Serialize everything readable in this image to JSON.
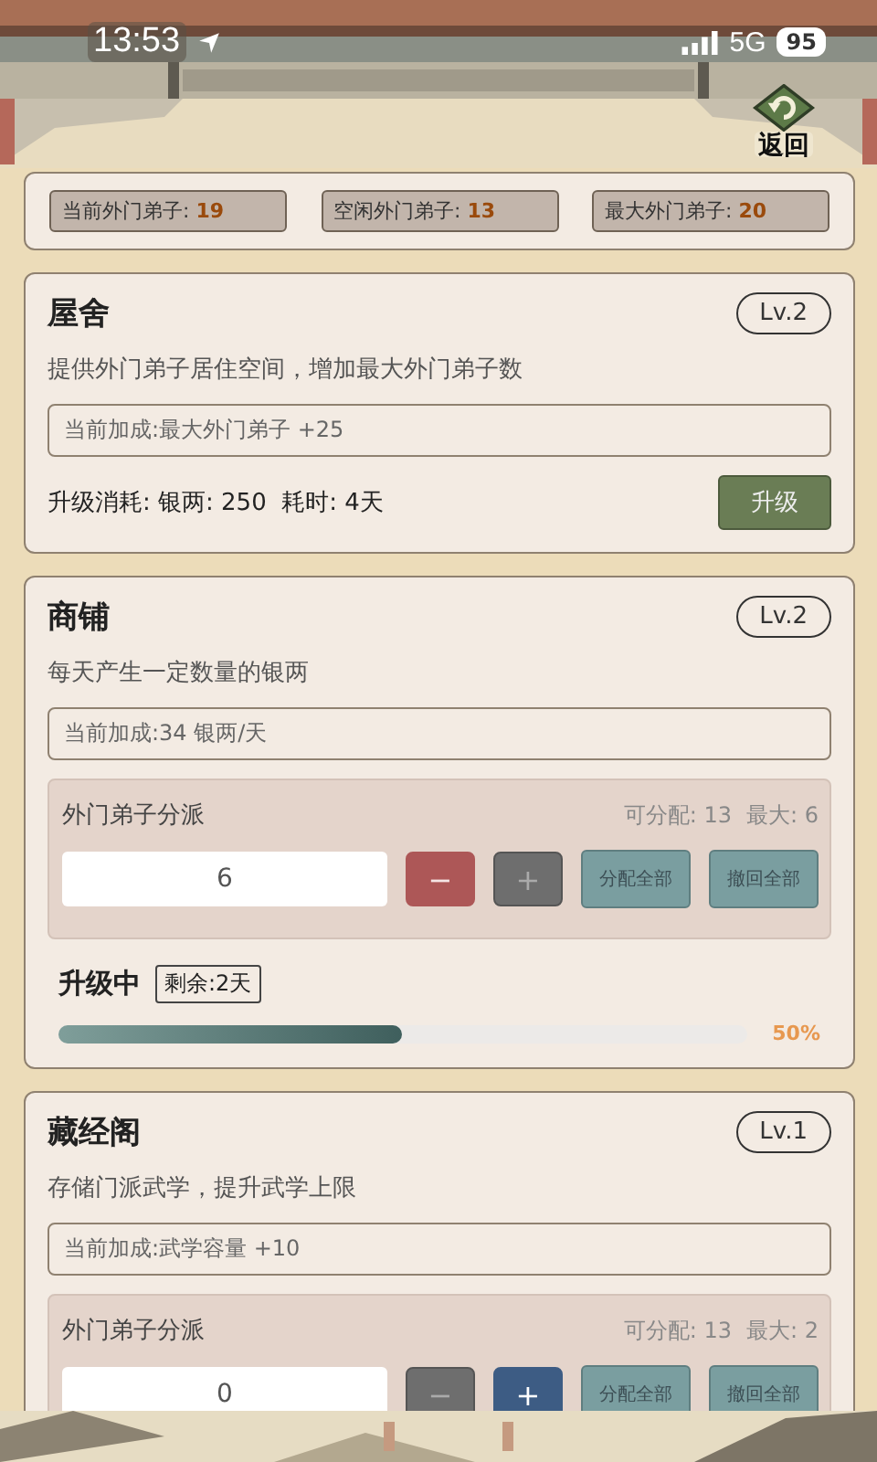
{
  "status_bar": {
    "time": "13:53",
    "network": "5G",
    "battery": "95"
  },
  "back_button": {
    "label": "返回"
  },
  "stats": [
    {
      "label": "当前外门弟子: ",
      "value": "19"
    },
    {
      "label": "空闲外门弟子: ",
      "value": "13"
    },
    {
      "label": "最大外门弟子: ",
      "value": "20"
    }
  ],
  "buildings": [
    {
      "name": "屋舍",
      "level": "Lv.2",
      "description": "提供外门弟子居住空间，增加最大外门弟子数",
      "bonus": "当前加成:最大外门弟子 +25",
      "footer": {
        "kind": "upgrade",
        "cost": "升级消耗: 银两: 250  耗时: 4天",
        "button": "升级"
      }
    },
    {
      "name": "商铺",
      "level": "Lv.2",
      "description": "每天产生一定数量的银两",
      "bonus": "当前加成:34 银两/天",
      "assign": {
        "title": "外门弟子分派",
        "available": "可分配: 13",
        "max": "最大: 6",
        "value": "6",
        "minus": "−",
        "minus_enabled": true,
        "plus": "+",
        "plus_enabled": false,
        "assign_all": "分配全部",
        "recall_all": "撤回全部"
      },
      "footer": {
        "kind": "upgrading",
        "title": "升级中",
        "remaining": "剩余:2天",
        "level": 0.5,
        "reading": "50%"
      }
    },
    {
      "name": "藏经阁",
      "level": "Lv.1",
      "description": "存储门派武学，提升武学上限",
      "bonus": "当前加成:武学容量 +10",
      "assign": {
        "title": "外门弟子分派",
        "available": "可分配: 13",
        "max": "最大: 2",
        "value": "0",
        "minus": "−",
        "minus_enabled": false,
        "plus": "+",
        "plus_enabled": true,
        "assign_all": "分配全部",
        "recall_all": "撤回全部"
      }
    }
  ]
}
